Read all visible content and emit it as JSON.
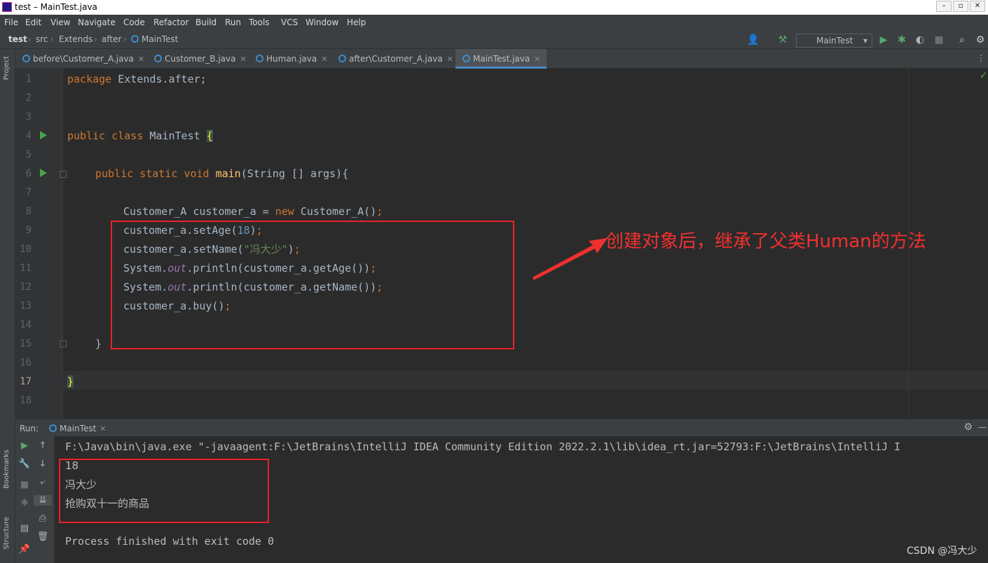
{
  "window": {
    "title": "test – MainTest.java"
  },
  "menu": [
    "File",
    "Edit",
    "View",
    "Navigate",
    "Code",
    "Refactor",
    "Build",
    "Run",
    "Tools",
    "VCS",
    "Window",
    "Help"
  ],
  "breadcrumb": [
    "test",
    "src",
    "Extends",
    "after",
    "MainTest"
  ],
  "run_config": "MainTest",
  "side_labels": {
    "project": "Project",
    "bookmarks": "Bookmarks",
    "structure": "Structure"
  },
  "tabs": [
    {
      "label": "before\\Customer_A.java",
      "active": false
    },
    {
      "label": "Customer_B.java",
      "active": false
    },
    {
      "label": "Human.java",
      "active": false
    },
    {
      "label": "after\\Customer_A.java",
      "active": false
    },
    {
      "label": "MainTest.java",
      "active": true
    }
  ],
  "editor": {
    "line_numbers": [
      "1",
      "2",
      "3",
      "4",
      "5",
      "6",
      "7",
      "8",
      "9",
      "10",
      "11",
      "12",
      "13",
      "14",
      "15",
      "16",
      "17",
      "18"
    ],
    "current_line": "17",
    "code": {
      "l1_kw": "package",
      "l1_rest": " Extends.after;",
      "l4_kw": "public class",
      "l4_name": " MainTest ",
      "l4_brace": "{",
      "l6_kw": "public static void",
      "l6_fn": "main",
      "l6_rest": "(String [] args){",
      "l8_a": "Customer_A customer_a = ",
      "l8_kw": "new",
      "l8_b": " Customer_A()",
      "l8_semi": ";",
      "l9_a": "customer_a.setAge(",
      "l9_num": "18",
      "l9_b": ")",
      "l9_semi": ";",
      "l10_a": "customer_a.setName(",
      "l10_str": "\"冯大少\"",
      "l10_b": ")",
      "l10_semi": ";",
      "l11_a": "System.",
      "l11_fld": "out",
      "l11_b": ".println(customer_a.getAge())",
      "l11_semi": ";",
      "l12_a": "System.",
      "l12_fld": "out",
      "l12_b": ".println(customer_a.getName())",
      "l12_semi": ";",
      "l13_a": "customer_a.buy()",
      "l13_semi": ";",
      "l15": "}",
      "l17": "}"
    }
  },
  "annotation": "创建对象后，继承了父类Human的方法",
  "run": {
    "label": "Run:",
    "tab": "MainTest",
    "command": "F:\\Java\\bin\\java.exe \"-javaagent:F:\\JetBrains\\IntelliJ IDEA Community Edition 2022.2.1\\lib\\idea_rt.jar=52793:F:\\JetBrains\\IntelliJ I",
    "output": [
      "18",
      "冯大少",
      "抢购双十一的商品"
    ],
    "exit": "Process finished with exit code 0"
  },
  "watermark": "CSDN @冯大少"
}
